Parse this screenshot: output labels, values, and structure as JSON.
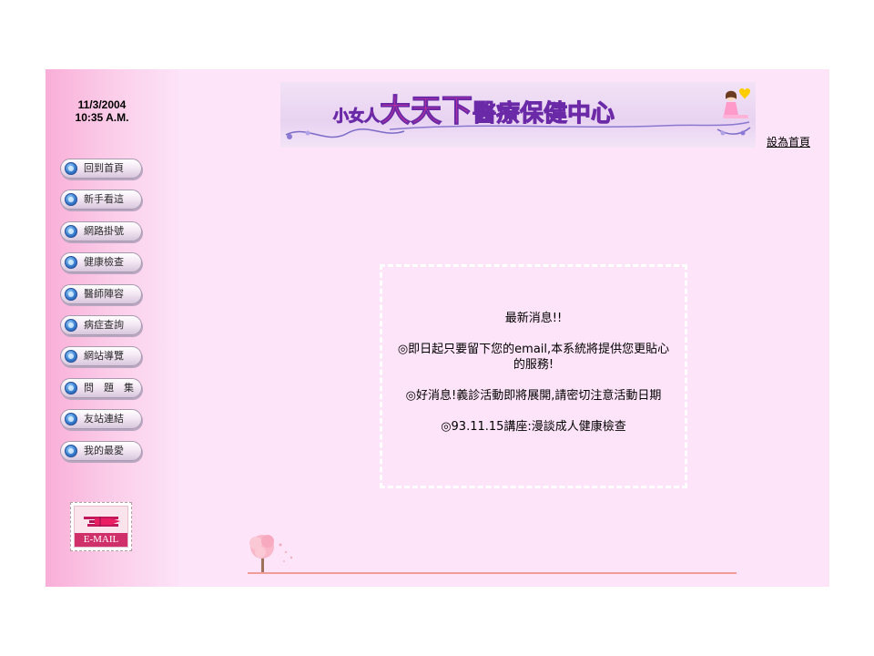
{
  "date": "11/3/2004",
  "time": "10:35 A.M.",
  "banner": {
    "title_part1": "小女人",
    "title_part2": "大天下",
    "title_part3": "醫療保健中心"
  },
  "set_home_label": "設為首頁",
  "nav": [
    {
      "label": "回到首頁"
    },
    {
      "label": "新手看這"
    },
    {
      "label": "網路掛號"
    },
    {
      "label": "健康檢查"
    },
    {
      "label": "醫師陣容"
    },
    {
      "label": "病症查詢"
    },
    {
      "label": "網站導覽"
    },
    {
      "label": "問　題　集"
    },
    {
      "label": "友站連結"
    },
    {
      "label": "我的最愛"
    }
  ],
  "email_label": "E-MAIL",
  "news": {
    "title": "最新消息!!",
    "items": [
      "◎即日起只要留下您的email,本系統將提供您更貼心的服務!",
      "◎好消息!義診活動即將展開,請密切注意活動日期",
      "◎93.11.15講座:漫談成人健康檢查"
    ]
  },
  "colors": {
    "page_background": "#fde4f8",
    "sidebar_pink": "#f9aed7",
    "title_magenta": "#e0309a",
    "title_outline": "#6a2aa8",
    "ground_line": "#f29b9b",
    "email_red": "#d0306a"
  },
  "icons": {
    "nav_bullet": "blue-orb-icon",
    "email": "airplane-stamp-icon",
    "banner_decoration": "girl-with-heart-icon",
    "footer_decoration": "cherry-tree-icon"
  }
}
